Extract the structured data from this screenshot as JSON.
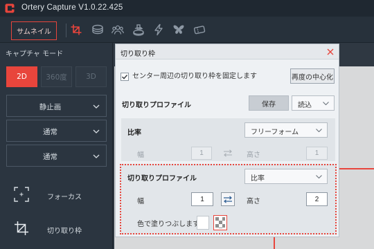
{
  "app": {
    "title": "Ortery Capture V1.0.22.425",
    "logo_icon": "ortery-logo-icon"
  },
  "toolbar": {
    "thumbnail_label": "サムネイル",
    "tools": [
      {
        "icon": "crop-icon",
        "active": true
      },
      {
        "icon": "layers-icon",
        "active": false
      },
      {
        "icon": "people-icon",
        "active": false
      },
      {
        "icon": "turntable-icon",
        "active": false
      },
      {
        "icon": "lightning-icon",
        "active": false
      },
      {
        "icon": "butterfly-icon",
        "active": false
      },
      {
        "icon": "ticket-icon",
        "active": false
      }
    ]
  },
  "left_panel": {
    "capture_mode_label": "キャプチャ モード",
    "modes": [
      {
        "label": "2D",
        "active": true
      },
      {
        "label": "360度",
        "active": false
      },
      {
        "label": "3D",
        "active": false
      }
    ],
    "selects": [
      {
        "value": "静止画"
      },
      {
        "value": "通常"
      },
      {
        "value": "通常"
      }
    ],
    "tools": [
      {
        "label": "フォーカス",
        "icon": "focus-icon"
      },
      {
        "label": "切り取り枠",
        "icon": "crop-icon"
      }
    ]
  },
  "crop_dialog": {
    "title": "切り取り枠",
    "close_icon": "close-icon",
    "fix_center": {
      "label": "センター周辺の切り取り枠を固定します",
      "checked": true
    },
    "recenter_label": "再度の中心化",
    "profile_label": "切り取りプロファイル",
    "save_label": "保存",
    "load_value": "読込",
    "ratio_section": {
      "label": "比率",
      "select_value": "フリーフォーム",
      "width_label": "幅",
      "width_value": "1",
      "height_label": "高さ",
      "height_value": "1",
      "enabled": false
    },
    "profile_section": {
      "label": "切り取りプロファイル",
      "select_value": "比率",
      "width_label": "幅",
      "width_value": "1",
      "height_label": "高さ",
      "height_value": "2",
      "fill_label": "色で塗りつぶします"
    }
  },
  "colors": {
    "accent": "#e8453c",
    "titlebar": "#1f2831",
    "toolbar": "#27313b",
    "panel": "#2b3540",
    "dialog": "#eef1f4",
    "icon_grey": "#8d98a4"
  }
}
